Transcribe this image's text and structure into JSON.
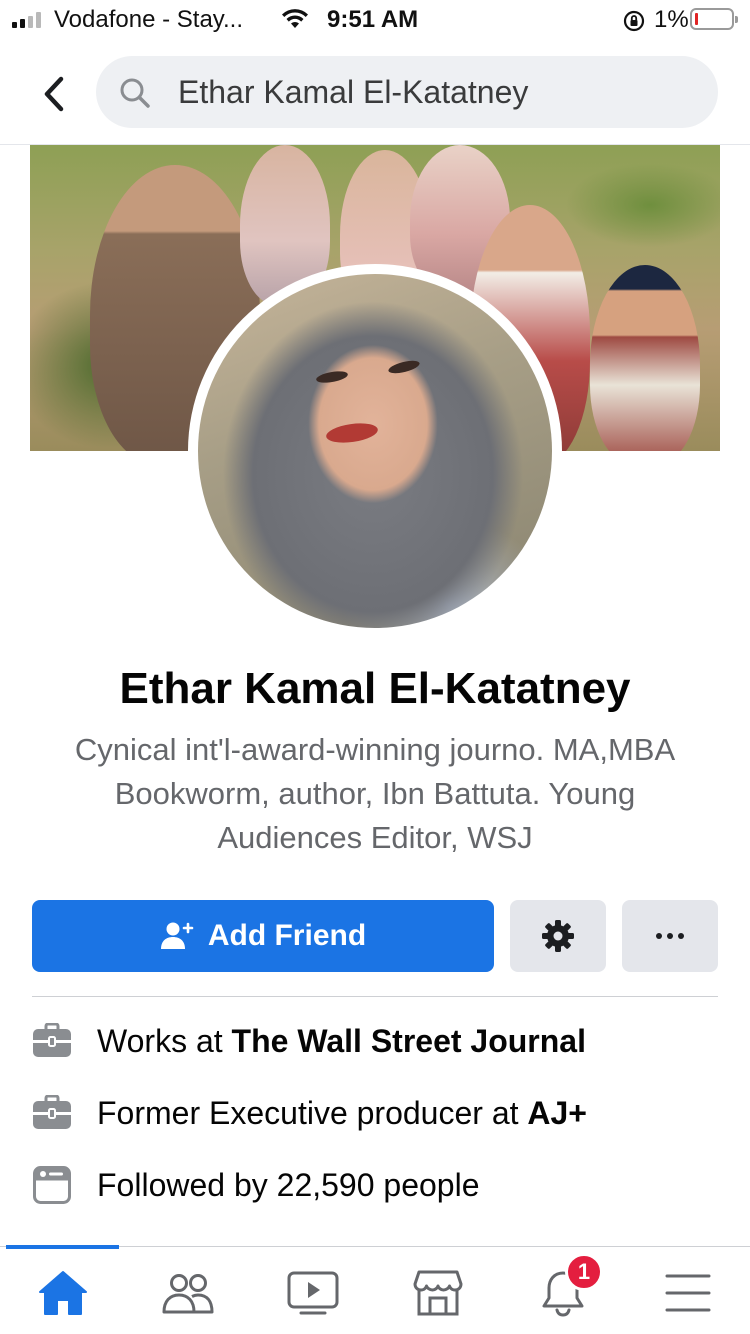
{
  "status_bar": {
    "carrier": "Vodafone - Stay...",
    "time": "9:51 AM",
    "battery_percent": "1%",
    "battery_level": 0.01,
    "signal_bars": 2,
    "signal_bars_total": 4
  },
  "header": {
    "back_icon": "chevron-left-icon",
    "search_text": "Ethar Kamal El-Katatney",
    "search_icon": "search-icon"
  },
  "profile": {
    "name": "Ethar Kamal El-Katatney",
    "bio_lines": [
      "Cynical int'l-award-winning journo. MA,MBA",
      "Bookworm, author, Ibn Battuta. Young",
      "Audiences Editor, WSJ"
    ]
  },
  "actions": {
    "add_friend_label": "Add Friend",
    "add_friend_icon": "add-person-icon",
    "settings_icon": "gear-icon",
    "more_icon": "more-horizontal-icon"
  },
  "info": [
    {
      "icon": "briefcase-icon",
      "prefix": "Works at ",
      "bold": "The Wall Street Journal"
    },
    {
      "icon": "briefcase-icon",
      "prefix": "Former Executive producer at ",
      "bold": "AJ+"
    },
    {
      "icon": "followers-card-icon",
      "prefix": "Followed by 22,590 people",
      "bold": ""
    }
  ],
  "tabbar": {
    "tabs": [
      {
        "name": "home",
        "icon": "home-icon",
        "active": true
      },
      {
        "name": "friends",
        "icon": "friends-icon",
        "active": false
      },
      {
        "name": "watch",
        "icon": "video-icon",
        "active": false
      },
      {
        "name": "marketplace",
        "icon": "marketplace-icon",
        "active": false
      },
      {
        "name": "notifications",
        "icon": "bell-icon",
        "active": false
      },
      {
        "name": "menu",
        "icon": "hamburger-menu-icon",
        "active": false
      }
    ],
    "notification_count": "1"
  },
  "colors": {
    "accent": "#1b74e4",
    "badge": "#e41e3f",
    "secondary_text": "#65676b",
    "button_gray": "#e4e6eb"
  }
}
